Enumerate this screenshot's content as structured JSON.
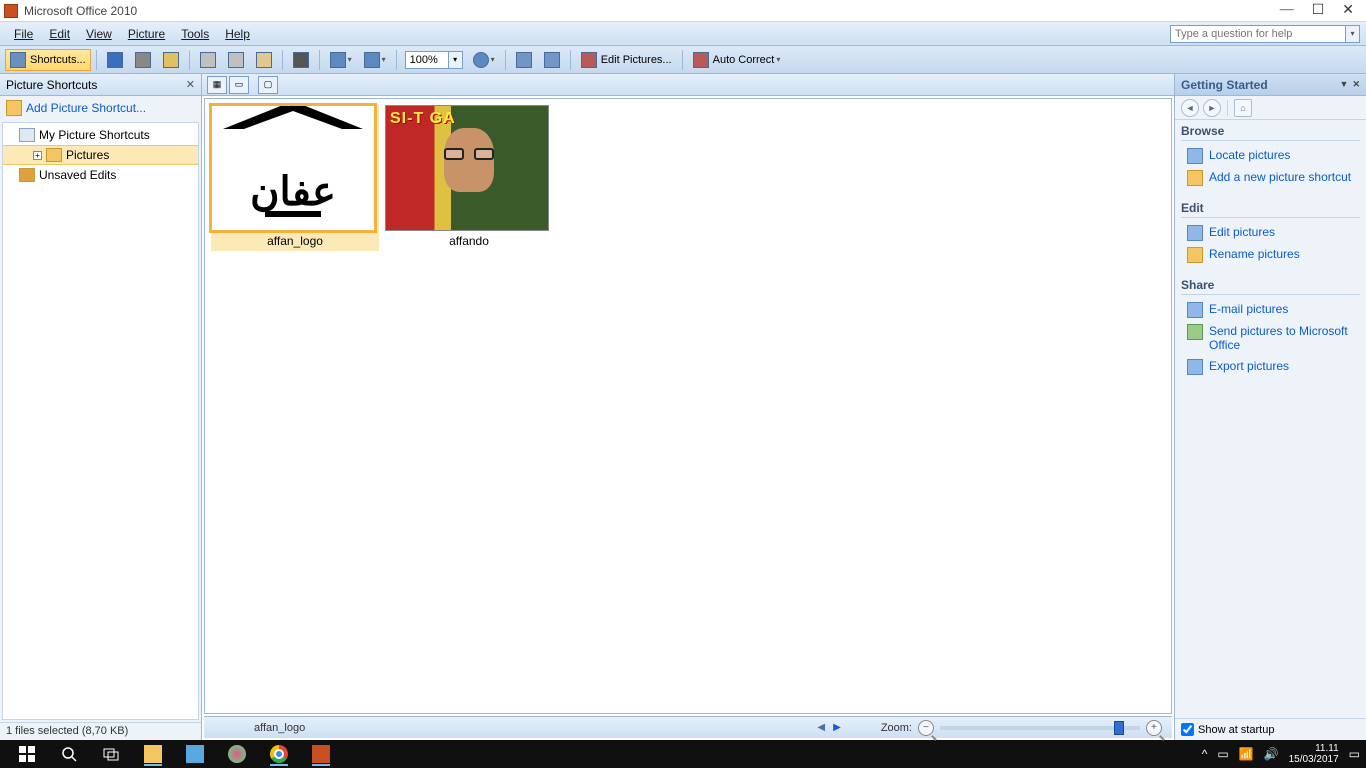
{
  "titlebar": {
    "title": "Microsoft Office 2010"
  },
  "menubar": {
    "items": [
      "File",
      "Edit",
      "View",
      "Picture",
      "Tools",
      "Help"
    ],
    "helpbox_placeholder": "Type a question for help"
  },
  "toolbar": {
    "shortcuts": "Shortcuts...",
    "zoom_value": "100%",
    "edit_pictures": "Edit Pictures...",
    "auto_correct": "Auto Correct"
  },
  "sidebar": {
    "title": "Picture Shortcuts",
    "add_link": "Add Picture Shortcut...",
    "tree": {
      "root": "My Picture Shortcuts",
      "pictures": "Pictures",
      "unsaved": "Unsaved Edits"
    },
    "status": "1 files selected (8,70 KB)"
  },
  "content": {
    "thumbs": [
      {
        "label": "affan_logo",
        "selected": true,
        "kind": "logo",
        "arabic": "عفان"
      },
      {
        "label": "affando",
        "selected": false,
        "kind": "photo",
        "banner": "SI-T   GA"
      }
    ],
    "current_name": "affan_logo",
    "zoom_label": "Zoom:"
  },
  "taskpane": {
    "title": "Getting Started",
    "sections": {
      "browse": {
        "title": "Browse",
        "links": [
          "Locate pictures",
          "Add a new picture shortcut"
        ]
      },
      "edit": {
        "title": "Edit",
        "links": [
          "Edit pictures",
          "Rename pictures"
        ]
      },
      "share": {
        "title": "Share",
        "links": [
          "E-mail pictures",
          "Send pictures to Microsoft Office",
          "Export pictures"
        ]
      }
    },
    "startup_label": "Show at startup"
  },
  "taskbar": {
    "time": "11.11",
    "date": "15/03/2017"
  }
}
